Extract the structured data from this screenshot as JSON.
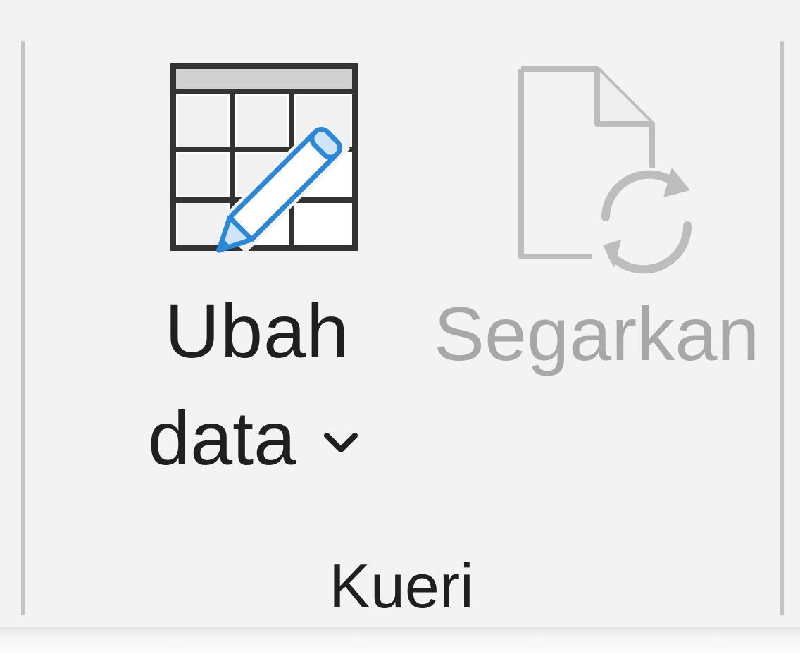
{
  "ribbon_group": {
    "label": "Kueri",
    "buttons": {
      "edit_data": {
        "label_line1": "Ubah",
        "label_line2": "data",
        "icon": "table-edit-icon",
        "has_dropdown": true,
        "enabled": true
      },
      "refresh": {
        "label": "Segarkan",
        "icon": "file-refresh-icon",
        "enabled": false
      }
    }
  },
  "colors": {
    "background": "#f3f3f3",
    "text": "#1f1f1f",
    "disabled_text": "#a8a8a8",
    "accent_blue": "#2b88d8",
    "separator": "#c4c4c4"
  }
}
